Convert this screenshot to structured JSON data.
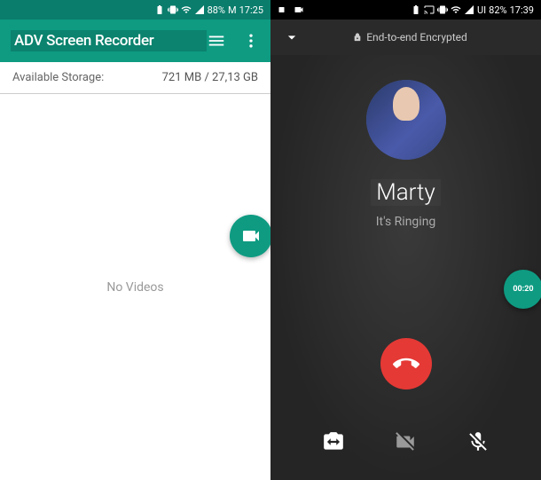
{
  "left": {
    "status": {
      "battery": "88%",
      "label_extra": "M",
      "time": "17:25"
    },
    "app": {
      "title": "ADV Screen Recorder"
    },
    "storage": {
      "label": "Available Storage:",
      "value": "721 MB / 27,13 GB"
    },
    "empty_text": "No Videos"
  },
  "right": {
    "status": {
      "battery": "82%",
      "label_extra": "UI",
      "time": "17:39"
    },
    "encryption_text": "End-to-end Encrypted",
    "call": {
      "name": "Marty",
      "status": "It's Ringing"
    },
    "timer": "00:20"
  }
}
